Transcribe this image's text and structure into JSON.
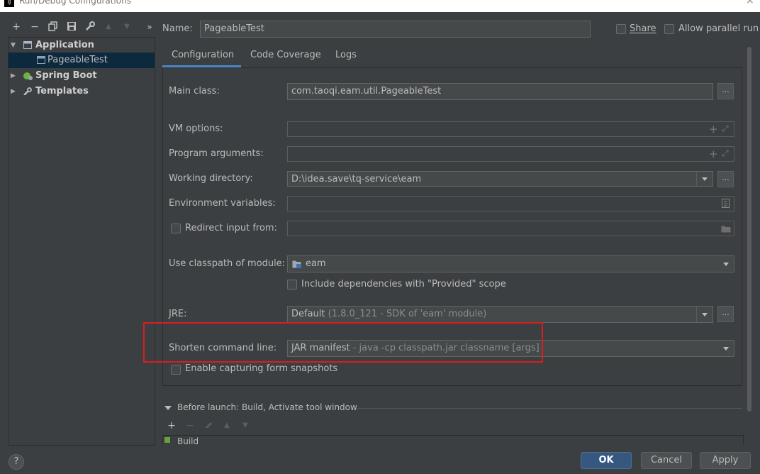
{
  "window": {
    "title": "Run/Debug Configurations",
    "close_glyph": "×"
  },
  "toolbar": {
    "add": "+",
    "remove": "−",
    "copy_icon": "copy-icon",
    "save_icon": "save-icon",
    "wrench_icon": "wrench-icon",
    "up": "▲",
    "down": "▼",
    "more": "»"
  },
  "tree": {
    "items": [
      {
        "label": "Application",
        "expanded": true
      },
      {
        "label": "PageableTest",
        "selected": true
      },
      {
        "label": "Spring Boot",
        "expanded": false
      },
      {
        "label": "Templates",
        "expanded": false
      }
    ]
  },
  "header": {
    "name_label": "Name:",
    "name_value": "PageableTest",
    "share_label": "Share",
    "allow_parallel_label": "Allow parallel run"
  },
  "tabs": [
    {
      "label": "Configuration",
      "active": true
    },
    {
      "label": "Code Coverage",
      "active": false
    },
    {
      "label": "Logs",
      "active": false
    }
  ],
  "form": {
    "main_class_label": "Main class:",
    "main_class_value": "com.taoqi.eam.util.PageableTest",
    "vm_options_label": "VM options:",
    "program_args_label": "Program arguments:",
    "working_dir_label": "Working directory:",
    "working_dir_value": "D:\\idea.save\\tq-service\\eam",
    "env_vars_label": "Environment variables:",
    "redirect_label": "Redirect input from:",
    "classpath_label": "Use classpath of module:",
    "classpath_value": "eam",
    "include_deps_label": "Include dependencies with \"Provided\" scope",
    "jre_label": "JRE:",
    "jre_value_main": "Default",
    "jre_value_detail": "(1.8.0_121 - SDK of 'eam' module)",
    "shorten_label": "Shorten command line:",
    "shorten_value_main": "JAR manifest",
    "shorten_value_detail": "- java -cp classpath.jar classname [args]",
    "capture_label": "Enable capturing form snapshots",
    "ellipsis": "..."
  },
  "before_launch": {
    "title": "Before launch: Build, Activate tool window",
    "add": "+",
    "remove": "−",
    "item_partial": "Build"
  },
  "footer": {
    "ok": "OK",
    "cancel": "Cancel",
    "apply": "Apply",
    "help": "?"
  },
  "colors": {
    "accent": "#365880",
    "highlight": "#d81e1e",
    "tab_underline": "#4a88c7"
  }
}
